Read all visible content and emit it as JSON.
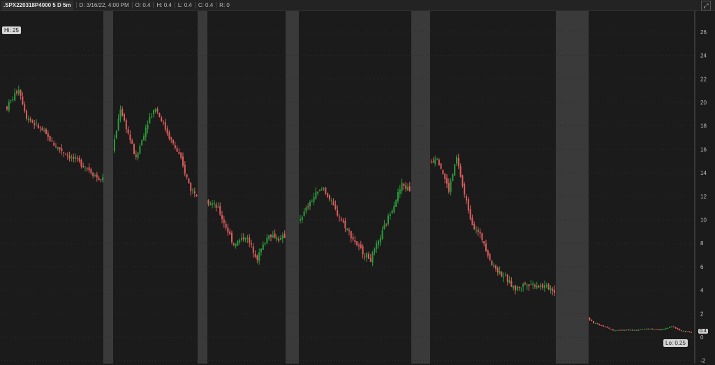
{
  "header": {
    "symbol": ".SPX220318P4000 5 D 5m",
    "date": "D: 3/16/22, 4:00 PM",
    "open": "O: 0.4",
    "high": "H: 0.4",
    "low": "L: 0.4",
    "close": "C: 0.4",
    "range": "R: 0"
  },
  "tags": {
    "hi": "Hi: 25",
    "lo": "Lo: 0.25",
    "last": "0.4"
  },
  "colors": {
    "up": "#2a9d3a",
    "down": "#e05c5c",
    "session_shade": "#3a3a3a",
    "background": "#1b1b1b"
  },
  "chart_data": {
    "type": "candlestick",
    "yticks": [
      -2,
      0,
      2,
      4,
      6,
      8,
      10,
      12,
      14,
      16,
      18,
      20,
      22,
      24,
      26
    ],
    "ylim": [
      -2,
      27
    ],
    "sessions": 5,
    "hi": 25,
    "lo": 0.25,
    "last": 0.4,
    "waypoints": [
      [
        0,
        19.6
      ],
      [
        3,
        21.2
      ],
      [
        5,
        18.8
      ],
      [
        9,
        17.6
      ],
      [
        12,
        16.4
      ],
      [
        16,
        15.4
      ],
      [
        20,
        14.6
      ],
      [
        24,
        13.3
      ],
      [
        27,
        15.8
      ],
      [
        29,
        19.5
      ],
      [
        33,
        15.2
      ],
      [
        36,
        18.4
      ],
      [
        38,
        19.6
      ],
      [
        41,
        17.4
      ],
      [
        44,
        15.5
      ],
      [
        47,
        12.6
      ],
      [
        51,
        11.8
      ],
      [
        54,
        10.9
      ],
      [
        56,
        9.4
      ],
      [
        58,
        7.9
      ],
      [
        61,
        8.6
      ],
      [
        64,
        6.8
      ],
      [
        67,
        8.8
      ],
      [
        70,
        8.3
      ],
      [
        73,
        9.2
      ],
      [
        76,
        10.6
      ],
      [
        79,
        12.2
      ],
      [
        81,
        12.7
      ],
      [
        84,
        10.8
      ],
      [
        87,
        9.2
      ],
      [
        90,
        7.6
      ],
      [
        93,
        6.6
      ],
      [
        95,
        8.1
      ],
      [
        98,
        10.6
      ],
      [
        101,
        13.0
      ],
      [
        104,
        12.3
      ],
      [
        107,
        14.6
      ],
      [
        110,
        15.4
      ],
      [
        113,
        12.5
      ],
      [
        115,
        15.3
      ],
      [
        117,
        12.1
      ],
      [
        119,
        9.7
      ],
      [
        122,
        8.1
      ],
      [
        124,
        6.2
      ],
      [
        127,
        5.2
      ],
      [
        130,
        4.1
      ],
      [
        133,
        4.6
      ],
      [
        136,
        4.4
      ],
      [
        139,
        4.2
      ],
      [
        142,
        3.3
      ],
      [
        145,
        2.7
      ],
      [
        147,
        2.2
      ],
      [
        150,
        1.2
      ],
      [
        152,
        1.0
      ],
      [
        155,
        0.6
      ],
      [
        158,
        0.6
      ],
      [
        161,
        0.6
      ],
      [
        164,
        0.7
      ],
      [
        167,
        0.6
      ],
      [
        170,
        0.9
      ],
      [
        172,
        0.6
      ],
      [
        175,
        0.4
      ]
    ]
  }
}
